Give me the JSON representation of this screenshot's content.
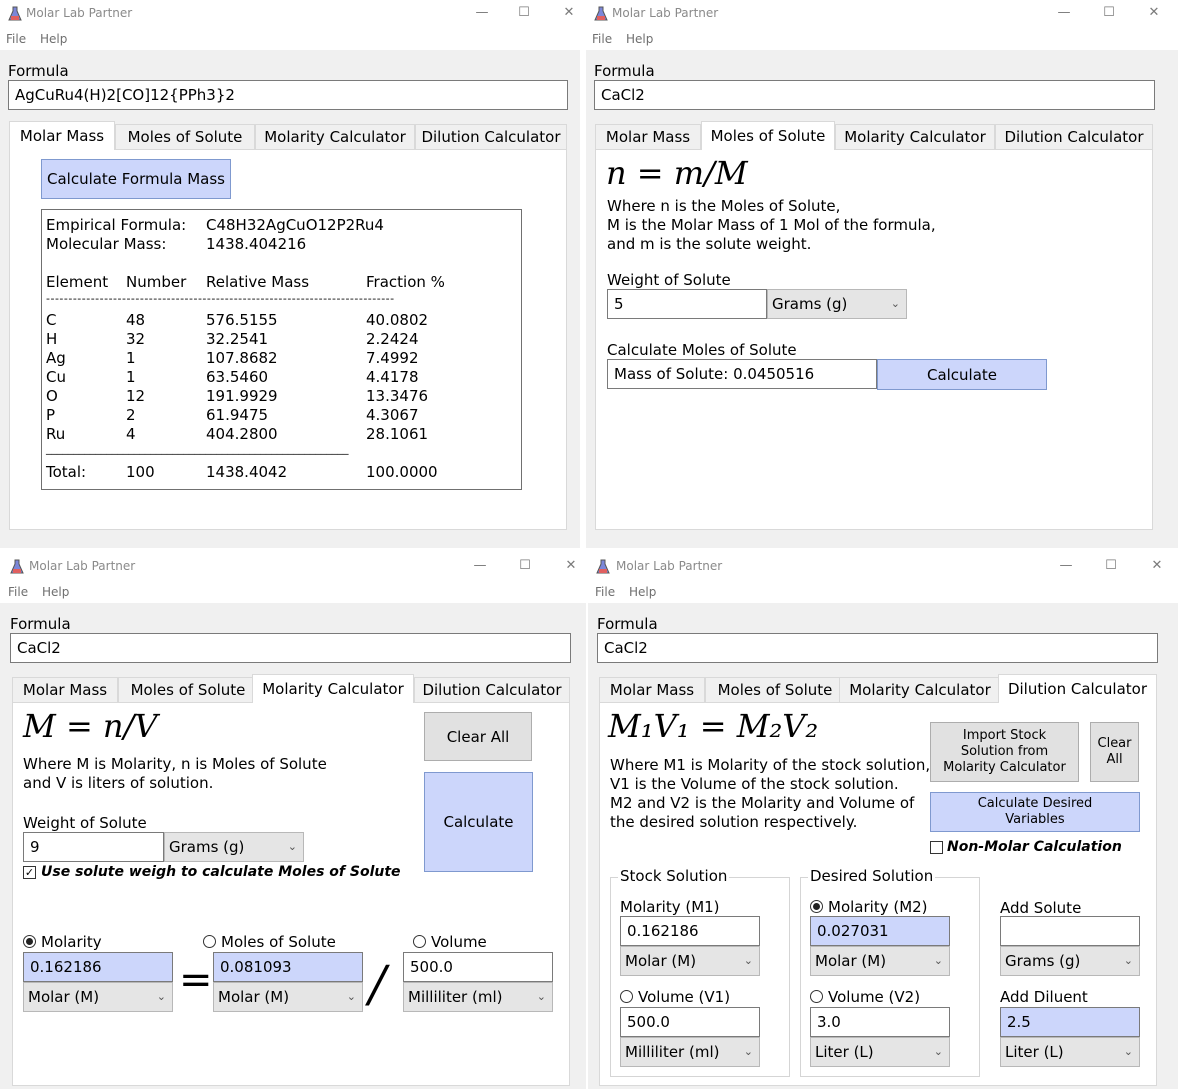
{
  "app_title": "Molar Lab Partner",
  "window_controls": {
    "minimize": "—",
    "maximize": "☐",
    "close": "✕"
  },
  "menu": {
    "file": "File",
    "help": "Help"
  },
  "formula_label": "Formula",
  "tabs": [
    "Molar Mass",
    "Moles of Solute",
    "Molarity Calculator",
    "Dilution Calculator"
  ],
  "w1": {
    "formula": "AgCuRu4(H)2[CO]12{PPh3}2",
    "calc_button": "Calculate Formula Mass",
    "empirical_label": "Empirical Formula:",
    "empirical_value": "C48H32AgCuO12P2Ru4",
    "molecular_label": "Molecular Mass:",
    "molecular_value": "1438.404216",
    "headers": [
      "Element",
      "Number",
      "Relative Mass",
      "Fraction %"
    ],
    "dash_line": "------------------------------------------------------------------------------",
    "rows": [
      [
        "C",
        "48",
        "576.5155",
        "40.0802"
      ],
      [
        "H",
        "32",
        "32.2541",
        "2.2424"
      ],
      [
        "Ag",
        "1",
        "107.8682",
        "7.4992"
      ],
      [
        "Cu",
        "1",
        "63.5460",
        "4.4178"
      ],
      [
        "O",
        "12",
        "191.9929",
        "13.3476"
      ],
      [
        "P",
        "2",
        "61.9475",
        "4.3067"
      ],
      [
        "Ru",
        "4",
        "404.2800",
        "28.1061"
      ]
    ],
    "under_line": "_______________________________________________________",
    "total": [
      "Total:",
      "100",
      "1438.4042",
      "100.0000"
    ]
  },
  "w2": {
    "formula": "CaCl2",
    "equation": "n = m/M",
    "desc": [
      "Where n is the Moles of Solute,",
      "M is the Molar Mass of 1 Mol of the formula,",
      "and m is the solute weight."
    ],
    "weight_label": "Weight of Solute",
    "weight_value": "5",
    "weight_unit": "Grams (g)",
    "calc_label": "Calculate Moles of Solute",
    "result": "Mass of Solute:   0.0450516",
    "calc_button": "Calculate"
  },
  "w3": {
    "formula": "CaCl2",
    "equation": "M = n/V",
    "desc": [
      "Where M is Molarity, n is Moles of Solute",
      "and V is liters of solution."
    ],
    "clear_button": "Clear All",
    "calc_button": "Calculate",
    "weight_label": "Weight of Solute",
    "weight_value": "9",
    "weight_unit": "Grams (g)",
    "use_weight_label": "Use solute weigh to calculate Moles of Solute",
    "molarity_label": "Molarity",
    "molarity_value": "0.162186",
    "molarity_unit": "Molar (M)",
    "moles_label": "Moles of Solute",
    "moles_value": "0.081093",
    "moles_unit": "Molar (M)",
    "volume_label": "Volume",
    "volume_value": "500.0",
    "volume_unit": "Milliliter (ml)",
    "equals": "=",
    "divide": "/"
  },
  "w4": {
    "formula": "CaCl2",
    "equation": "M₁V₁ = M₂V₂",
    "desc": [
      "Where M1 is Molarity of the stock solution,",
      "V1 is the Volume of the stock solution.",
      "M2 and V2 is the Molarity and Volume of",
      "the desired solution respectively."
    ],
    "import_button": "Import Stock Solution from Molarity Calculator",
    "clear_button": "Clear All",
    "calc_button": "Calculate Desired Variables",
    "non_molar_label": "Non-Molar Calculation",
    "stock_title": "Stock Solution",
    "desired_title": "Desired Solution",
    "m1_label": "Molarity (M1)",
    "m1_value": "0.162186",
    "m1_unit": "Molar (M)",
    "v1_label": "Volume (V1)",
    "v1_value": "500.0",
    "v1_unit": "Milliliter (ml)",
    "m2_label": "Molarity (M2)",
    "m2_value": "0.027031",
    "m2_unit": "Molar (M)",
    "v2_label": "Volume (V2)",
    "v2_value": "3.0",
    "v2_unit": "Liter (L)",
    "add_solute_label": "Add Solute",
    "add_solute_value": "",
    "add_solute_unit": "Grams (g)",
    "add_diluent_label": "Add Diluent",
    "add_diluent_value": "2.5",
    "add_diluent_unit": "Liter (L)"
  }
}
